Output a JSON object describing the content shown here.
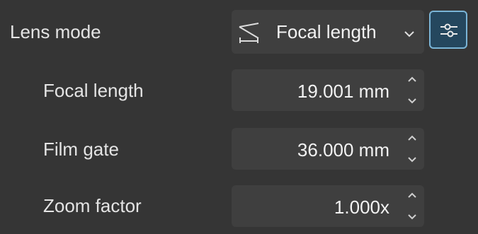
{
  "lens_mode": {
    "label": "Lens mode",
    "selected": "Focal length",
    "mode_icon": "focal-length-mode-icon",
    "chevron_icon": "chevron-down-icon",
    "settings_icon": "sliders-icon",
    "settings_active_color": "#25475e",
    "settings_border_color": "#7ab4d6"
  },
  "fields": [
    {
      "label": "Focal length",
      "value": "19.001 mm"
    },
    {
      "label": "Film gate",
      "value": "36.000 mm"
    },
    {
      "label": "Zoom factor",
      "value": "1.000x"
    }
  ]
}
